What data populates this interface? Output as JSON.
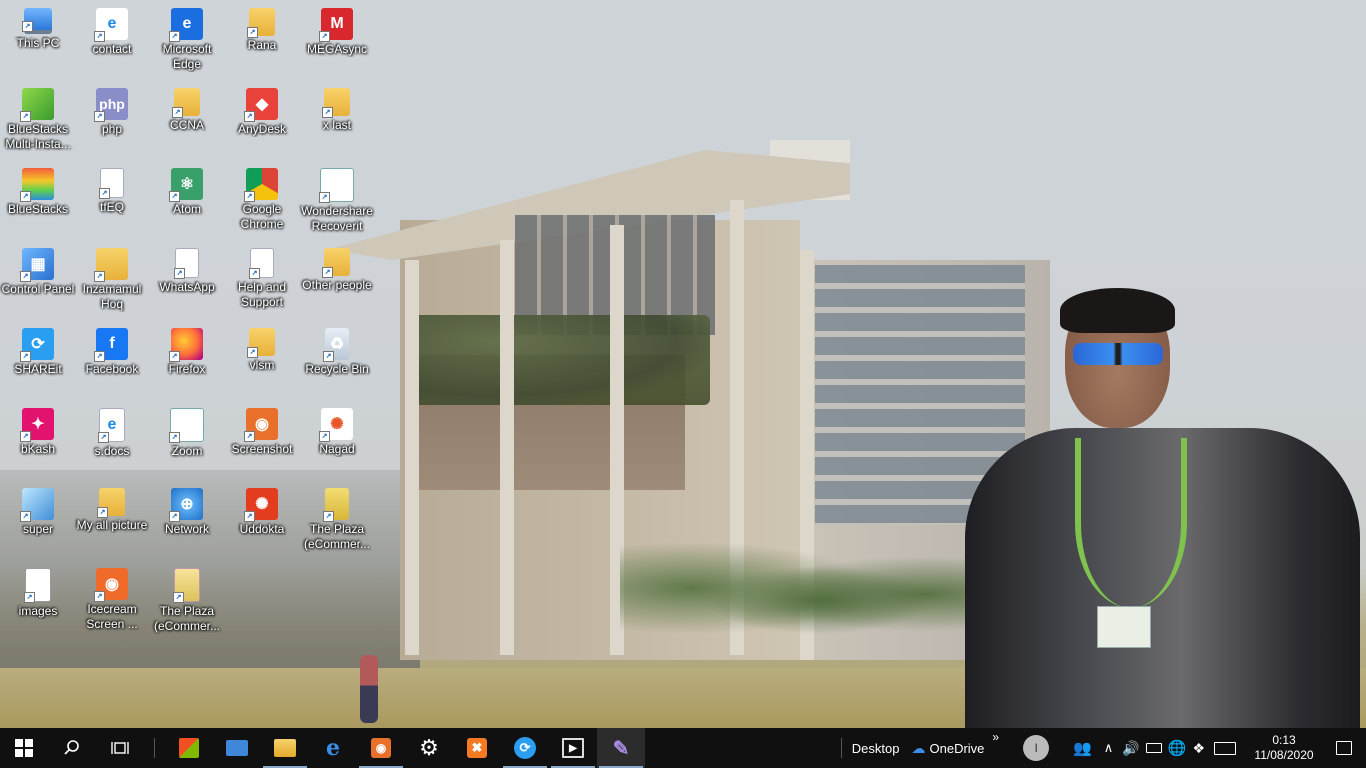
{
  "desktop": {
    "icons": [
      {
        "label": "This PC",
        "icon": "this-pc-icon"
      },
      {
        "label": "contact",
        "icon": "internet-explorer-icon"
      },
      {
        "label": "Microsoft Edge",
        "icon": "edge-icon"
      },
      {
        "label": "Rana",
        "icon": "folder-icon"
      },
      {
        "label": "MEGAsync",
        "icon": "mega-icon"
      },
      {
        "label": "BlueStacks Multi-Insta...",
        "icon": "bluestacks-multi-icon"
      },
      {
        "label": "php",
        "icon": "php-icon"
      },
      {
        "label": "CCNA",
        "icon": "folder-icon"
      },
      {
        "label": "AnyDesk",
        "icon": "anydesk-icon"
      },
      {
        "label": "x last",
        "icon": "folder-icon"
      },
      {
        "label": "BlueStacks",
        "icon": "bluestacks-icon"
      },
      {
        "label": "tfEQ",
        "icon": "document-icon"
      },
      {
        "label": "Atom",
        "icon": "atom-icon"
      },
      {
        "label": "Google Chrome",
        "icon": "chrome-icon"
      },
      {
        "label": "Wondershare Recoverit",
        "icon": "wondershare-icon"
      },
      {
        "label": "Control Panel",
        "icon": "control-panel-icon"
      },
      {
        "label": "Inzamamul Hoq",
        "icon": "user-folder-icon"
      },
      {
        "label": "WhatsApp",
        "icon": "document-icon"
      },
      {
        "label": "Help and Support",
        "icon": "document-icon"
      },
      {
        "label": "Other people",
        "icon": "folder-icon"
      },
      {
        "label": "SHAREit",
        "icon": "shareit-icon"
      },
      {
        "label": "Facebook",
        "icon": "facebook-icon"
      },
      {
        "label": "Firefox",
        "icon": "firefox-icon"
      },
      {
        "label": "vlsm",
        "icon": "folder-icon"
      },
      {
        "label": "Recycle Bin",
        "icon": "recycle-bin-icon"
      },
      {
        "label": "bKash",
        "icon": "bkash-icon"
      },
      {
        "label": "s.docs",
        "icon": "edge-doc-icon"
      },
      {
        "label": "Zoom",
        "icon": "zoom-icon"
      },
      {
        "label": "Screenshot",
        "icon": "screenshot-icon"
      },
      {
        "label": "Nagad",
        "icon": "nagad-icon"
      },
      {
        "label": "super",
        "icon": "super-icon"
      },
      {
        "label": "My all picture",
        "icon": "folder-icon"
      },
      {
        "label": "Network",
        "icon": "network-icon"
      },
      {
        "label": "Uddokta",
        "icon": "uddokta-icon"
      },
      {
        "label": "The Plaza (eCommer...",
        "icon": "zip-folder-icon"
      },
      {
        "label": "images",
        "icon": "image-file-icon"
      },
      {
        "label": "Icecream Screen ...",
        "icon": "icecream-icon"
      },
      {
        "label": "The Plaza (eCommer...",
        "icon": "zip-file-icon"
      }
    ]
  },
  "taskbar": {
    "start_icon": "windows-start-icon",
    "search_icon": "search-icon",
    "task_view_icon": "task-view-icon",
    "pinned": [
      {
        "name": "microsoft-store-icon",
        "glyph": "🛍"
      },
      {
        "name": "remote-desktop-icon",
        "glyph": "▭"
      },
      {
        "name": "file-explorer-icon",
        "glyph": "▬"
      },
      {
        "name": "edge-taskbar-icon",
        "glyph": "e"
      },
      {
        "name": "screenshot-taskbar-icon",
        "glyph": "◉"
      },
      {
        "name": "settings-icon",
        "glyph": "⚙"
      },
      {
        "name": "xampp-icon",
        "glyph": "✖"
      },
      {
        "name": "shareit-taskbar-icon",
        "glyph": "⟳"
      },
      {
        "name": "video-editor-icon",
        "glyph": "▶"
      },
      {
        "name": "feather-app-icon",
        "glyph": "✎"
      }
    ],
    "desktop_label": "Desktop",
    "onedrive_label": "OneDrive",
    "avatar_initial": "I",
    "clock_time": "0:13",
    "clock_date": "11/08/2020"
  },
  "colors": {
    "taskbar_bg": "#101010",
    "accent": "#8aa9c9"
  }
}
